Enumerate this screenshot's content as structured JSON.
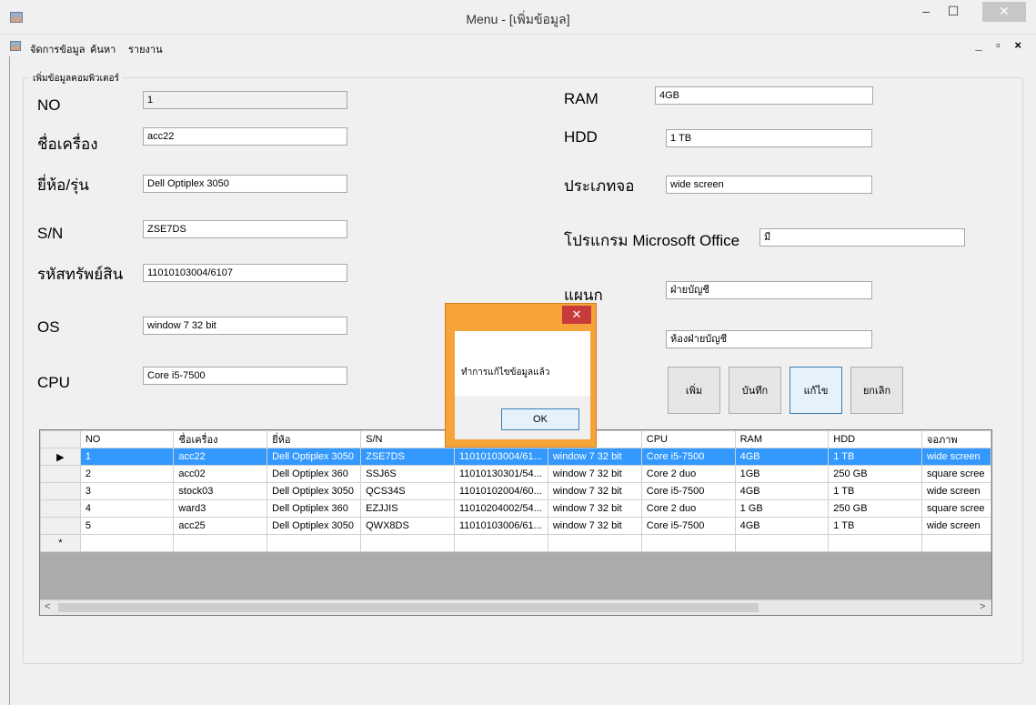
{
  "window": {
    "title": "Menu - [เพิ่มข้อมูล]",
    "minimize": "–",
    "maximize": "☐",
    "close": "✕"
  },
  "menu": {
    "items": [
      "จัดการข้อมูล",
      "ค้นหา",
      "รายงาน"
    ],
    "mdi_controls": "_ ▫ ×"
  },
  "form": {
    "group_title": "เพิ่มข้อมูลคอมพิวเตอร์",
    "labels": {
      "no": "NO",
      "name": "ชื่อเครื่อง",
      "brand": "ยี่ห้อ/รุ่น",
      "sn": "S/N",
      "asset": "รหัสทรัพย์สิน",
      "os": "OS",
      "cpu": "CPU",
      "ram": "RAM",
      "hdd": "HDD",
      "screen": "ประเภทจอ",
      "office": "โปรแกรม Microsoft Office",
      "dept": "แผนก"
    },
    "values": {
      "no": "1",
      "name": "acc22",
      "brand": "Dell Optiplex 3050",
      "sn": "ZSE7DS",
      "asset": "11010103004/6107",
      "os": "window 7 32 bit",
      "cpu": "Core i5-7500",
      "ram": "4GB",
      "hdd": "1 TB",
      "screen": "wide screen",
      "office": "มี",
      "dept": "ฝ่ายบัญชี",
      "room": "ห้องฝ่ายบัญชี"
    },
    "buttons": {
      "add": "เพิ่ม",
      "save": "บันทึก",
      "edit": "แก้ไข",
      "cancel": "ยกเลิก"
    }
  },
  "grid": {
    "headers": [
      "NO",
      "ชื่อเครื่อง",
      "ยี่ห้อ",
      "S/N",
      "",
      "",
      "CPU",
      "RAM",
      "HDD",
      "จอภาพ"
    ],
    "current_row_marker": "▶",
    "new_row_marker": "*",
    "rows": [
      [
        "1",
        "acc22",
        "Dell Optiplex 3050",
        "ZSE7DS",
        "11010103004/61...",
        "window 7 32 bit",
        "Core i5-7500",
        "4GB",
        "1 TB",
        "wide screen"
      ],
      [
        "2",
        "acc02",
        "Dell Optiplex 360",
        "SSJ6S",
        "11010130301/54...",
        "window 7 32 bit",
        "Core 2 duo",
        "1GB",
        "250 GB",
        "square scree"
      ],
      [
        "3",
        "stock03",
        "Dell Optiplex 3050",
        "QCS34S",
        "11010102004/60...",
        "window 7 32 bit",
        "Core i5-7500",
        "4GB",
        "1 TB",
        "wide screen"
      ],
      [
        "4",
        "ward3",
        "Dell Optiplex 360",
        "EZJJIS",
        "11010204002/54...",
        "window 7 32 bit",
        "Core 2 duo",
        "1 GB",
        "250 GB",
        "square scree"
      ],
      [
        "5",
        "acc25",
        "Dell Optiplex 3050",
        "QWX8DS",
        "11010103006/61...",
        "window 7 32 bit",
        "Core i5-7500",
        "4GB",
        "1 TB",
        "wide screen"
      ]
    ]
  },
  "dialog": {
    "message": "ทำการแก้ไขข้อมูลแล้ว",
    "ok": "OK",
    "close": "✕"
  }
}
